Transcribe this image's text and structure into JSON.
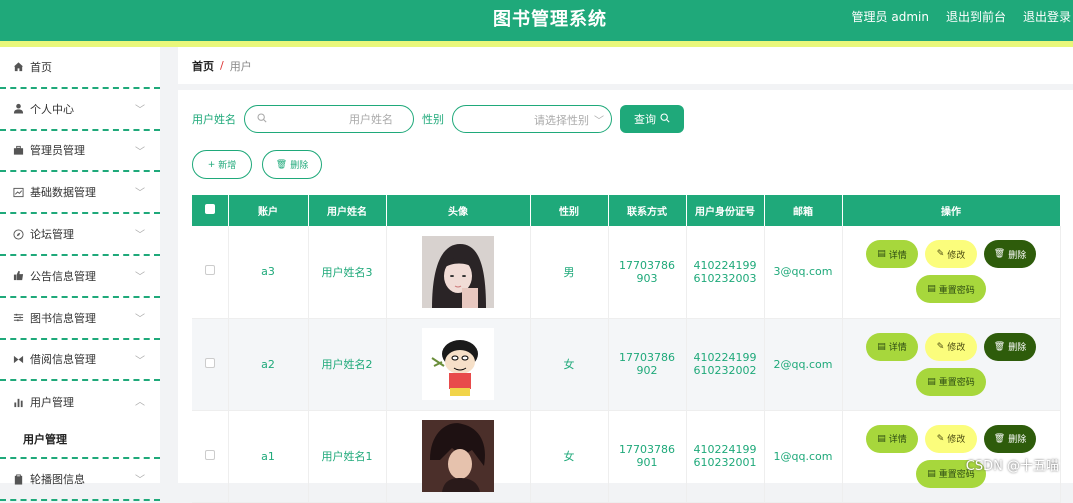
{
  "header": {
    "title": "图书管理系统",
    "admin": "管理员 admin",
    "to_front": "退出到前台",
    "logout": "退出登录"
  },
  "sidebar": {
    "items": [
      {
        "label": "首页",
        "icon": "home-icon"
      },
      {
        "label": "个人中心",
        "icon": "user-icon"
      },
      {
        "label": "管理员管理",
        "icon": "briefcase-icon"
      },
      {
        "label": "基础数据管理",
        "icon": "chart-icon"
      },
      {
        "label": "论坛管理",
        "icon": "compass-icon"
      },
      {
        "label": "公告信息管理",
        "icon": "thumb-icon"
      },
      {
        "label": "图书信息管理",
        "icon": "sliders-icon"
      },
      {
        "label": "借阅信息管理",
        "icon": "swap-icon"
      },
      {
        "label": "用户管理",
        "icon": "bars-icon"
      },
      {
        "label": "轮播图信息",
        "icon": "clipboard-icon"
      }
    ],
    "sub_active": "用户管理"
  },
  "breadcrumb": {
    "home": "首页",
    "sep": "/",
    "current": "用户"
  },
  "search": {
    "name_label": "用户姓名",
    "name_placeholder": "用户姓名",
    "gender_label": "性别",
    "gender_placeholder": "请选择性别",
    "query_label": "查询"
  },
  "actions": {
    "add": "新增",
    "delete": "删除"
  },
  "table": {
    "headers": [
      "账户",
      "用户姓名",
      "头像",
      "性别",
      "联系方式",
      "用户身份证号",
      "邮箱",
      "操作"
    ],
    "rows": [
      {
        "account": "a3",
        "name": "用户姓名3",
        "gender": "男",
        "phone": "17703786903",
        "idcard": "410224199610232003",
        "email": "3@qq.com"
      },
      {
        "account": "a2",
        "name": "用户姓名2",
        "gender": "女",
        "phone": "17703786902",
        "idcard": "410224199610232002",
        "email": "2@qq.com"
      },
      {
        "account": "a1",
        "name": "用户姓名1",
        "gender": "女",
        "phone": "17703786901",
        "idcard": "410224199610232001",
        "email": "1@qq.com"
      }
    ],
    "ops": {
      "detail": "详情",
      "edit": "修改",
      "delete": "删除",
      "reset": "重置密码"
    }
  },
  "watermark": "CSDN @十五喵",
  "colors": {
    "primary": "#1fa97a",
    "strip": "#e9f77a",
    "detail": "#a7d73c",
    "edit": "#fbfd7c",
    "delete": "#2e5c0b"
  }
}
